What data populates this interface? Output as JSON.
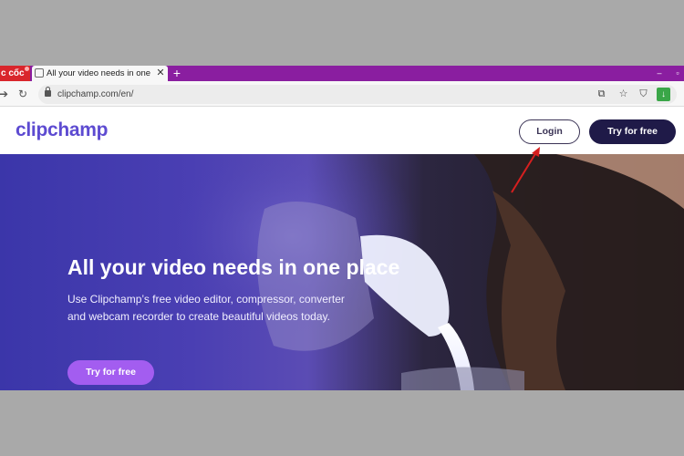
{
  "browser": {
    "brand_label": "c cốc",
    "tab_title": "All your video needs in one p",
    "tab_close": "✕",
    "new_tab": "+",
    "url": "clipchamp.com/en/",
    "icons": [
      "back-icon",
      "reload-icon",
      "lock-icon",
      "translate-icon",
      "star-icon",
      "shield-icon",
      "download-icon"
    ]
  },
  "header": {
    "logo_text": "clipchamp",
    "login_label": "Login",
    "try_label": "Try for free"
  },
  "hero": {
    "title": "All your video needs in one place",
    "description": "Use Clipchamp’s free video editor, compressor, converter and webcam recorder to create beautiful videos today.",
    "cta_label": "Try for free"
  },
  "colors": {
    "tab_strip": "#8a1ea0",
    "brand_badge": "#d9262c",
    "logo": "#5d4bd1",
    "primary_button": "#1f1a48",
    "cta_button": "#a35df0",
    "annotation_arrow": "#d61f1f"
  }
}
